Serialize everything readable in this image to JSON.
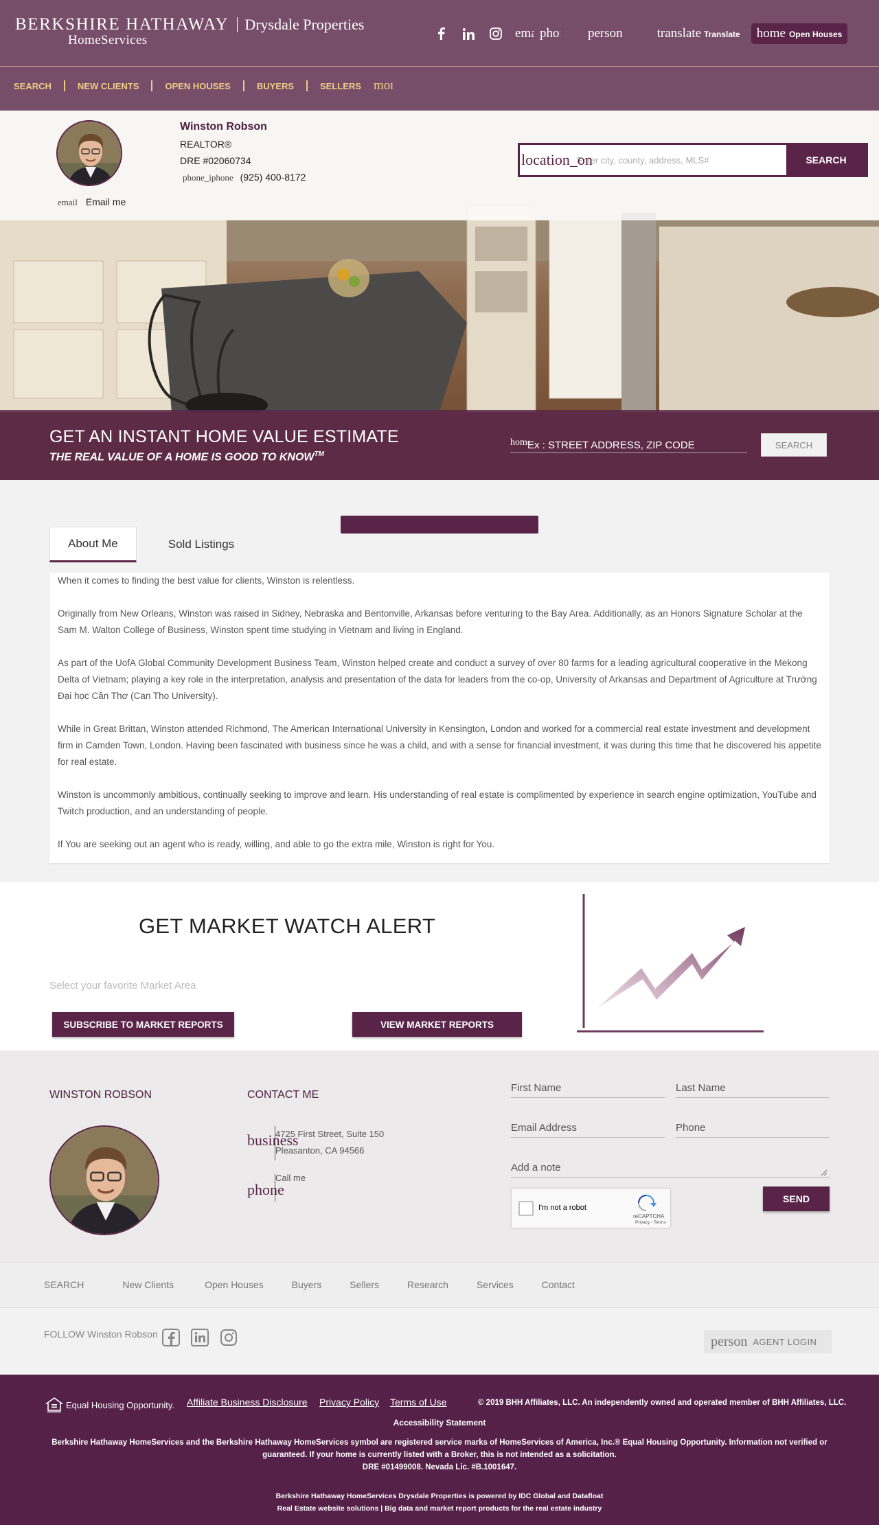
{
  "header": {
    "brand_name": "BERKSHIRE HATHAWAY",
    "brand_sub": "HomeServices",
    "office_name": "Drysdale Properties",
    "icon_email_text": "email",
    "icon_phone_text": "phone",
    "icon_person_text": "person",
    "translate_icon_text": "translate",
    "translate_label": "Translate",
    "home_icon_text": "home",
    "open_houses_label": "Open Houses"
  },
  "nav": {
    "items": [
      "SEARCH",
      "NEW CLIENTS",
      "OPEN HOUSES",
      "BUYERS",
      "SELLERS"
    ],
    "more_icon_text": "more_horiz"
  },
  "agent": {
    "name": "Winston Robson",
    "title": "REALTOR®",
    "license": "DRE #02060734",
    "phone_icon_text": "phone_iphone",
    "phone": "(925) 400-8172",
    "email_icon_text": "email",
    "email_label": "Email me"
  },
  "search": {
    "icon_text": "location_on",
    "placeholder": "Enter city, county, address, MLS#",
    "button_label": "SEARCH"
  },
  "home_value": {
    "title": "GET AN INSTANT HOME VALUE ESTIMATE",
    "subtitle": "THE REAL VALUE OF A HOME IS GOOD TO KNOW",
    "subtitle_mark": "TM",
    "icon_text": "home",
    "placeholder": "Ex : STREET ADDRESS, ZIP CODE",
    "button_label": "SEARCH"
  },
  "tabs": [
    "About Me",
    "Sold Listings"
  ],
  "about": {
    "paragraphs": [
      "When it comes to finding the best value for clients, Winston is relentless.",
      "Originally from New Orleans, Winston was raised in Sidney, Nebraska and Bentonville, Arkansas before venturing to the Bay Area. Additionally, as an Honors Signature Scholar at the Sam M. Walton College of Business, Winston spent time studying in Vietnam and living in England.",
      "As part of the UofA Global Community Development Business Team, Winston helped create and conduct a survey of over 80 farms for a leading agricultural cooperative in the Mekong Delta of Vietnam; playing a key role in the interpretation, analysis and presentation of the data for leaders from the co-op, University of Arkansas and Department of Agriculture at Trường Đại học Cần Thơ (Can Tho University).",
      "While in Great Brittan, Winston attended Richmond, The American International University in Kensington, London and worked for a commercial real estate investment and development firm in Camden Town, London. Having been fascinated with business since he was a child, and with a sense for financial investment, it was during this time that he discovered his appetite for real estate.",
      "Winston is uncommonly ambitious, continually seeking to improve and learn. His understanding of real estate is complimented by experience in search engine optimization, YouTube and Twitch production, and an understanding of people.",
      "If You are seeking out an agent who is ready, willing, and able to go the extra mile, Winston is right for You."
    ]
  },
  "market_watch": {
    "title": "GET MARKET WATCH ALERT",
    "select_placeholder": "Select your favorite Market Area",
    "subscribe_label": "SUBSCRIBE TO MARKET REPORTS",
    "view_label": "VIEW MARKET REPORTS"
  },
  "contact": {
    "agent_heading": "WINSTON ROBSON",
    "contact_heading": "CONTACT ME",
    "address_icon_text": "business",
    "address_line1": "4725 First Street, Suite 150",
    "address_line2": "Pleasanton, CA 94566",
    "phone_icon_text": "phone",
    "call_label": "Call me",
    "first_name_placeholder": "First Name",
    "last_name_placeholder": "Last Name",
    "email_placeholder": "Email Address",
    "phone_placeholder": "Phone",
    "note_placeholder": "Add a note",
    "captcha_label": "I'm not a robot",
    "captcha_brand": "reCAPTCHA",
    "captcha_terms": "Privacy - Terms",
    "send_label": "SEND"
  },
  "footer_nav": [
    "SEARCH",
    "New Clients",
    "Open Houses",
    "Buyers",
    "Sellers",
    "Research",
    "Services",
    "Contact"
  ],
  "follow": {
    "label": "FOLLOW Winston Robson",
    "login_icon_text": "person",
    "login_label": "AGENT LOGIN"
  },
  "bottom": {
    "equal_housing": "Equal Housing Opportunity.",
    "links": [
      "Affiliate Business Disclosure",
      "Privacy Policy",
      "Terms of Use"
    ],
    "copyright": "© 2019 BHH Affiliates, LLC. An independently owned and operated member of BHH Affiliates, LLC.",
    "accessibility": "Accessibility Statement",
    "legal": "Berkshire Hathaway HomeServices and the Berkshire Hathaway HomeServices symbol are registered service marks of HomeServices of America, Inc.® Equal Housing Opportunity. Information not verified or guaranteed. If your home is currently listed with a Broker, this is not intended as a solicitation.",
    "license": "DRE #01499008. Nevada Lic. #B.1001647.",
    "powered_line1": "Berkshire Hathaway HomeServices Drysdale Properties is powered by IDC Global and Datafloat",
    "powered_line2": "Real Estate website solutions | Big data and market report products for the real estate industry"
  },
  "colors": {
    "brand_purple": "#5a2448",
    "nav_gold": "#f1cc86",
    "footer_purple": "#552148"
  }
}
